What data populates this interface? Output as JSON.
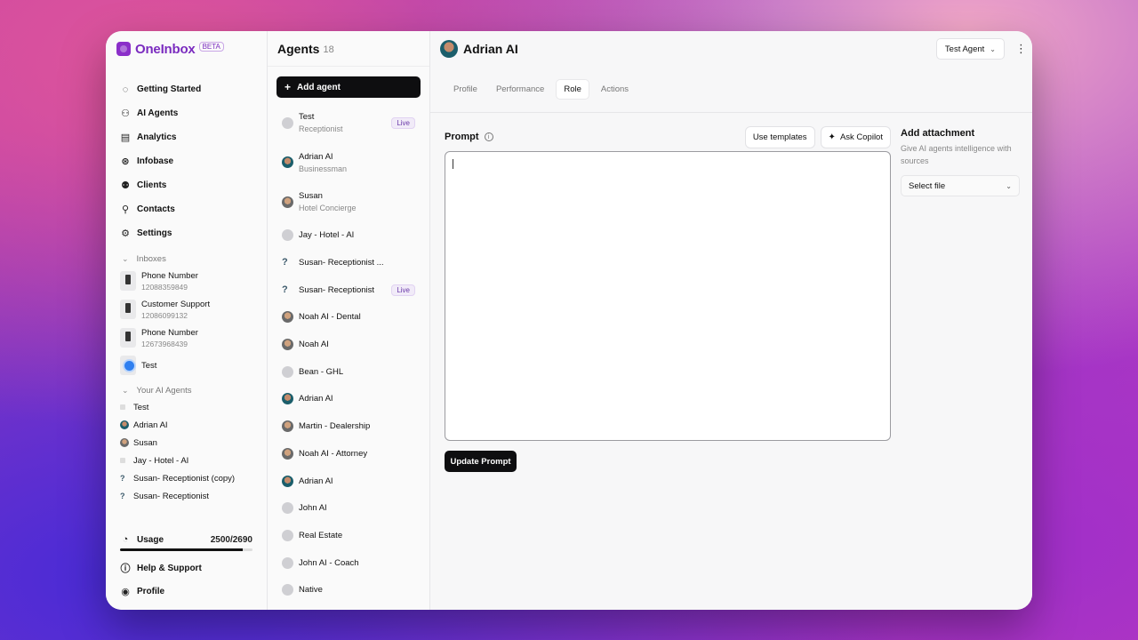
{
  "brand": {
    "name": "OneInbox",
    "badge": "BETA"
  },
  "nav": [
    {
      "label": "Getting Started",
      "icon": "progress-icon"
    },
    {
      "label": "AI Agents",
      "icon": "agents-icon"
    },
    {
      "label": "Analytics",
      "icon": "chart-icon"
    },
    {
      "label": "Infobase",
      "icon": "database-icon"
    },
    {
      "label": "Clients",
      "icon": "clients-icon"
    },
    {
      "label": "Contacts",
      "icon": "contact-icon"
    },
    {
      "label": "Settings",
      "icon": "gear-icon"
    }
  ],
  "inboxes": {
    "label": "Inboxes",
    "items": [
      {
        "title": "Phone Number",
        "sub": "12088359849"
      },
      {
        "title": "Customer Support",
        "sub": "12086099132"
      },
      {
        "title": "Phone Number",
        "sub": "12673968439"
      },
      {
        "title": "Test",
        "sub": ""
      }
    ]
  },
  "your_agents": {
    "label": "Your AI Agents",
    "items": [
      "Test",
      "Adrian AI",
      "Susan",
      "Jay - Hotel - AI",
      "Susan- Receptionist (copy)",
      "Susan- Receptionist"
    ]
  },
  "usage": {
    "label": "Usage",
    "value": "2500/2690",
    "fraction": 0.929
  },
  "bottom_nav": [
    {
      "label": "Help & Support",
      "icon": "help-icon"
    },
    {
      "label": "Profile",
      "icon": "profile-icon"
    }
  ],
  "agents_panel": {
    "title": "Agents",
    "count": "18",
    "add_label": "Add agent",
    "list": [
      {
        "name": "Test",
        "role": "Receptionist",
        "live": "Live"
      },
      {
        "name": "Adrian AI",
        "role": "Businessman",
        "live": ""
      },
      {
        "name": "Susan",
        "role": "Hotel Concierge",
        "live": ""
      },
      {
        "name": "Jay - Hotel - AI",
        "role": "",
        "live": ""
      },
      {
        "name": "Susan- Receptionist ...",
        "role": "",
        "live": ""
      },
      {
        "name": "Susan- Receptionist",
        "role": "",
        "live": "Live"
      },
      {
        "name": "Noah AI - Dental",
        "role": "",
        "live": ""
      },
      {
        "name": "Noah AI",
        "role": "",
        "live": ""
      },
      {
        "name": "Bean - GHL",
        "role": "",
        "live": ""
      },
      {
        "name": "Adrian AI",
        "role": "",
        "live": ""
      },
      {
        "name": "Martin - Dealership",
        "role": "",
        "live": ""
      },
      {
        "name": "Noah AI - Attorney",
        "role": "",
        "live": ""
      },
      {
        "name": "Adrian AI",
        "role": "",
        "live": ""
      },
      {
        "name": "John AI",
        "role": "",
        "live": ""
      },
      {
        "name": "Real Estate",
        "role": "",
        "live": ""
      },
      {
        "name": "John AI - Coach",
        "role": "",
        "live": ""
      },
      {
        "name": "Native",
        "role": "",
        "live": ""
      }
    ]
  },
  "main": {
    "title": "Adrian AI",
    "agent_select": "Test Agent",
    "tabs": [
      "Profile",
      "Performance",
      "Role",
      "Actions"
    ],
    "active_tab": "Role",
    "prompt_label": "Prompt",
    "templates_label": "Use templates",
    "copilot_label": "Ask Copilot",
    "prompt_value": "",
    "update_label": "Update Prompt",
    "attachment": {
      "title": "Add attachment",
      "desc": "Give AI agents intelligence with sources",
      "select": "Select file"
    }
  }
}
